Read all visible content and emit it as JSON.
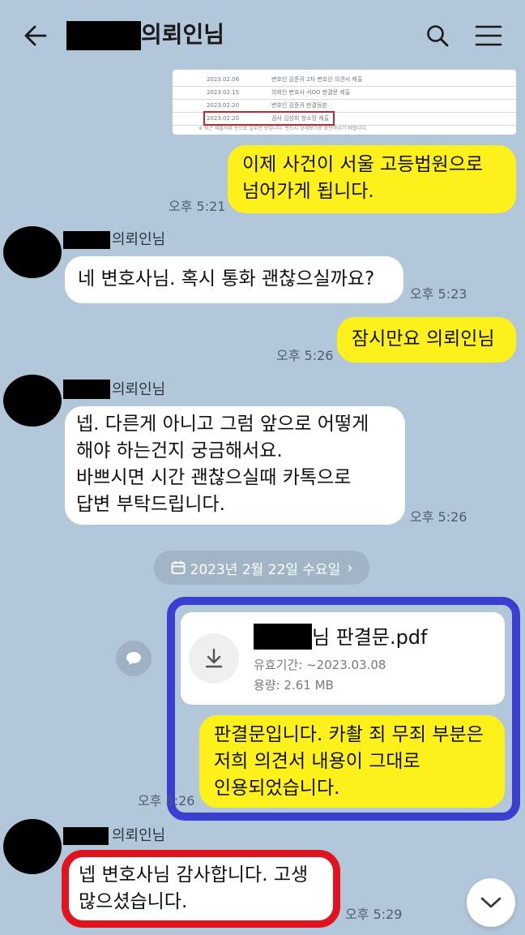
{
  "header": {
    "title_suffix": "의뢰인님",
    "back_icon": "arrow-left-icon",
    "search_icon": "search-icon",
    "menu_icon": "hamburger-menu-icon"
  },
  "preview_image": {
    "rows": [
      {
        "date": "2023.02.06",
        "text": "변호인 김준귀 2차 변호인 의견서 제출"
      },
      {
        "date": "2023.02.15",
        "text": "의뢰인 변호사 서OO 판결문 제출"
      },
      {
        "date": "2023.02.20",
        "text": "변호인 김준귀 판결등본"
      },
      {
        "date": "2023.02.20",
        "text": "검사 김성희 항소장 제출"
      }
    ],
    "footnote": "※ 최근 제출서류 순으로 일부만 보입니다. 반드시 상세보기로 확인하시기 바랍니다."
  },
  "messages": [
    {
      "side": "me",
      "text": "이제 사건이 서울 고등법원으로\n넘어가게 됩니다.",
      "time": "오후 5:21"
    },
    {
      "side": "other",
      "sender": "의뢰인님",
      "text": "네 변호사님. 혹시 통화 괜찮으실까요?",
      "time": "오후 5:23"
    },
    {
      "side": "me",
      "text": "잠시만요 의뢰인님",
      "time": "오후 5:26"
    },
    {
      "side": "other",
      "sender": "의뢰인님",
      "text": "넵. 다른게 아니고 그럼 앞으로 어떻게\n해야 하는건지 궁금해서요.\n바쁘시면 시간 괜찮으실때 카톡으로\n답변 부탁드립니다.",
      "time": "오후 5:26"
    },
    {
      "side": "me",
      "text": "판결문입니다. 카촬 죄 무죄 부분은\n저희 의견서 내용이 그대로\n인용되었습니다.",
      "time": "오후 5:26"
    },
    {
      "side": "other",
      "sender": "의뢰인님",
      "text": "넵 변호사님 감사합니다. 고생\n많으셨습니다.",
      "time": "오후 5:29"
    }
  ],
  "date_divider": {
    "label": "2023년 2월 22일 수요일",
    "icon": "calendar-icon",
    "chevron": "›"
  },
  "file_message": {
    "name_suffix": "님 판결문.pdf",
    "expiry": "유효기간: ~2023.03.08",
    "size": "용량: 2.61 MB",
    "icon": "download-icon"
  },
  "colors": {
    "background": "#b2c7d9",
    "my_bubble": "#fef01b",
    "other_bubble": "#ffffff",
    "highlight_blue": "#3a3fcf",
    "highlight_red": "#e0141e"
  }
}
